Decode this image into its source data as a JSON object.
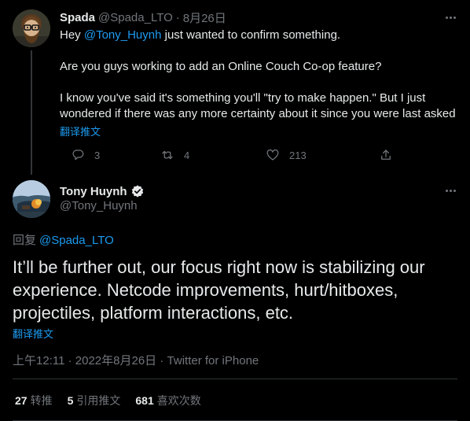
{
  "reply_tweet": {
    "author_name": "Spada",
    "author_handle": "@Spada_LTO",
    "separator": "·",
    "date": "8月26日",
    "lines": [
      {
        "before": "Hey ",
        "mention": "@Tony_Huynh",
        "after": " just wanted to confirm something."
      },
      {
        "text": "Are you guys working to add an Online Couch Co-op feature?"
      },
      {
        "text": "I know you've said it's something you'll \"try to make happen.\" But I just"
      },
      {
        "text": "wondered if there was any more certainty about it since you were last asked"
      }
    ],
    "translate_label": "翻译推文",
    "actions": {
      "reply_count": "3",
      "retweet_count": "4",
      "like_count": "213"
    },
    "icons": [
      "reply-icon",
      "retweet-icon",
      "like-icon",
      "share-icon",
      "more-icon"
    ]
  },
  "main_tweet": {
    "author_name": "Tony Huynh",
    "author_handle": "@Tony_Huynh",
    "verified": true,
    "replying_label": "回复",
    "replying_to": "@Spada_LTO",
    "text_lines": [
      "It’ll be further out, our focus right now is stabilizing our",
      "experience. Netcode improvements, hurt/hitboxes,",
      "projectiles, platform interactions, etc."
    ],
    "translate_label": "翻译推文",
    "time": "上午12:11",
    "separator": "·",
    "date": "2022年8月26日",
    "source": "Twitter for iPhone",
    "stats": {
      "retweets": "27",
      "retweets_label": "转推",
      "quotes": "5",
      "quotes_label": "引用推文",
      "likes": "681",
      "likes_label": "喜欢次数"
    }
  },
  "colors": {
    "background": "#000000",
    "text": "#e7e9ea",
    "muted": "#71767b",
    "link": "#1d9bf0",
    "border": "#2f3336"
  }
}
